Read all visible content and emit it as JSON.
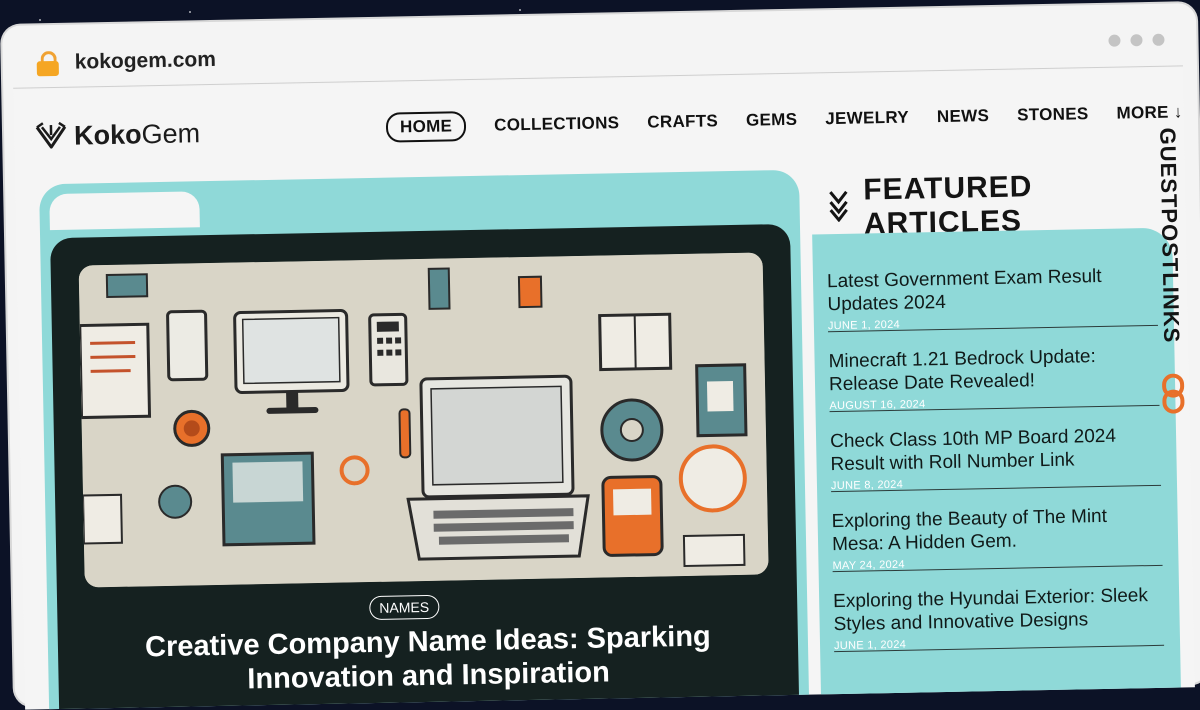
{
  "browser": {
    "url": "kokogem.com"
  },
  "logo": {
    "bold": "Koko",
    "regular": "Gem"
  },
  "nav": {
    "items": [
      "HOME",
      "COLLECTIONS",
      "CRAFTS",
      "GEMS",
      "JEWELRY",
      "NEWS",
      "STONES",
      "MORE ↓"
    ],
    "active": "HOME"
  },
  "main_article": {
    "category": "NAMES",
    "title": "Creative Company Name Ideas: Sparking Innovation and Inspiration"
  },
  "featured": {
    "heading": "FEATURED ARTICLES",
    "articles": [
      {
        "title": "Latest Government Exam Result Updates 2024",
        "date": "JUNE 1, 2024"
      },
      {
        "title": "Minecraft 1.21 Bedrock Update: Release Date Revealed!",
        "date": "AUGUST 16, 2024"
      },
      {
        "title": "Check Class 10th MP Board 2024 Result with Roll Number Link",
        "date": "JUNE 8, 2024"
      },
      {
        "title": "Exploring the Beauty of The Mint Mesa: A Hidden Gem.",
        "date": "MAY 24, 2024"
      },
      {
        "title": "Exploring the Hyundai Exterior: Sleek Styles and Innovative Designs",
        "date": "JUNE 1, 2024"
      }
    ]
  },
  "watermark": {
    "text": "GUESTPOSTLINKS"
  },
  "colors": {
    "accent": "#8fd9d8",
    "dark": "#152120",
    "orange": "#e8702a"
  }
}
